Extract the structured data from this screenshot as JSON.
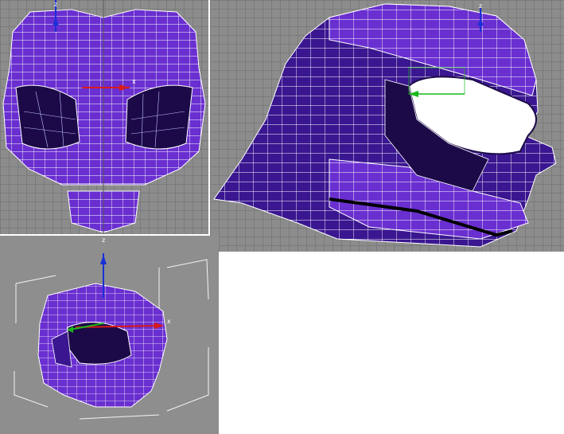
{
  "viewports": {
    "front": {
      "axis_labels": {
        "z": "z",
        "x": "x"
      }
    },
    "side": {
      "axis_labels": {
        "z": "z"
      }
    },
    "perspective": {
      "axis_labels": {
        "z": "z",
        "x": "x"
      }
    }
  },
  "colors": {
    "grid_background": "#8c8c8c",
    "grid_lines": "#7b7b7b",
    "mesh_fill": "#6a2fd0",
    "mesh_dark": "#1c0a48",
    "wireframe": "#ffffff",
    "axis_z": "#1a2fd8",
    "axis_x": "#d81a1a",
    "axis_y": "#1ab81a"
  }
}
